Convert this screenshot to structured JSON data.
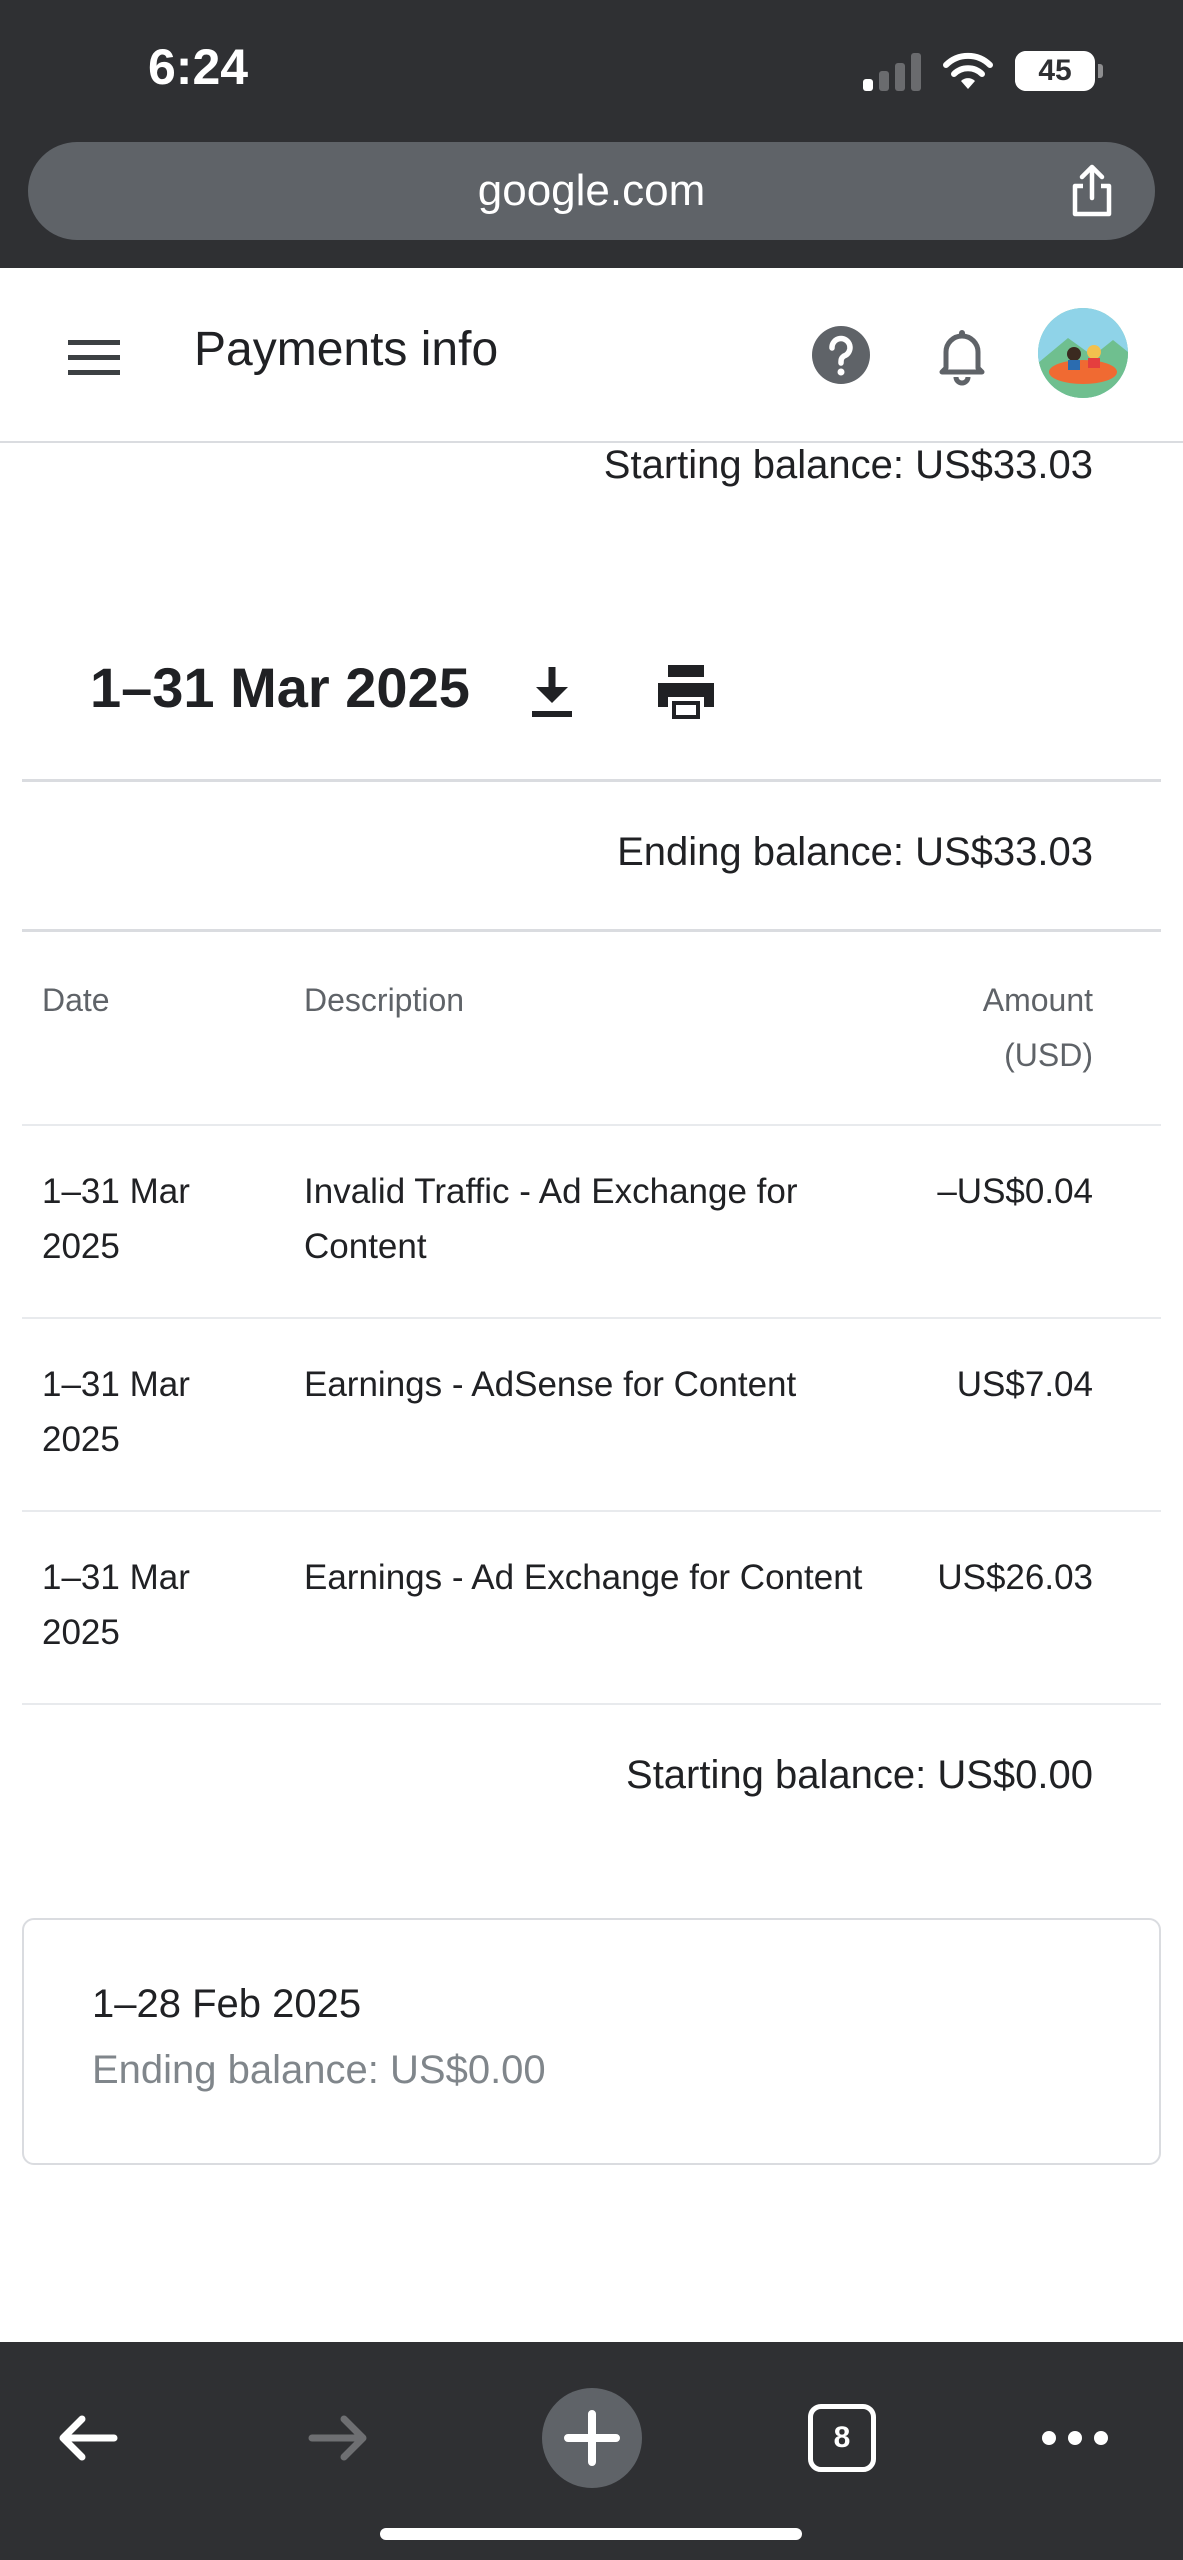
{
  "status_bar": {
    "time": "6:24",
    "battery": "45",
    "battery_level_pct": 45
  },
  "browser": {
    "url": "google.com",
    "tab_count": "8"
  },
  "appbar": {
    "title": "Payments info"
  },
  "statement": {
    "prev_starting_balance": "Starting balance: US$33.03",
    "period": "1–31 Mar 2025",
    "ending_balance": "Ending balance: US$33.03",
    "columns": {
      "date": "Date",
      "description": "Description",
      "amount_line1": "Amount",
      "amount_line2": "(USD)"
    },
    "rows": [
      {
        "date_line1": "1–31 Mar",
        "date_line2": "2025",
        "desc_line1": "Invalid Traffic - Ad Exchange for",
        "desc_line2": "Content",
        "amount": "–US$0.04"
      },
      {
        "date_line1": "1–31 Mar",
        "date_line2": "2025",
        "desc_line1": "Earnings - AdSense for Content",
        "desc_line2": "",
        "amount": "US$7.04"
      },
      {
        "date_line1": "1–31 Mar",
        "date_line2": "2025",
        "desc_line1": "Earnings - Ad Exchange for Content",
        "desc_line2": "",
        "amount": "US$26.03"
      }
    ],
    "starting_balance": "Starting balance: US$0.00"
  },
  "previous_statement": {
    "period": "1–28 Feb 2025",
    "ending_balance": "Ending balance: US$0.00"
  },
  "icons": {
    "menu": "hamburger-menu-icon",
    "help": "help-circle-icon",
    "notifications": "bell-icon",
    "download": "download-icon",
    "print": "print-icon",
    "share": "share-icon",
    "back": "arrow-left-icon",
    "forward": "arrow-right-icon",
    "new_tab": "plus-icon",
    "more": "more-horizontal-icon"
  }
}
